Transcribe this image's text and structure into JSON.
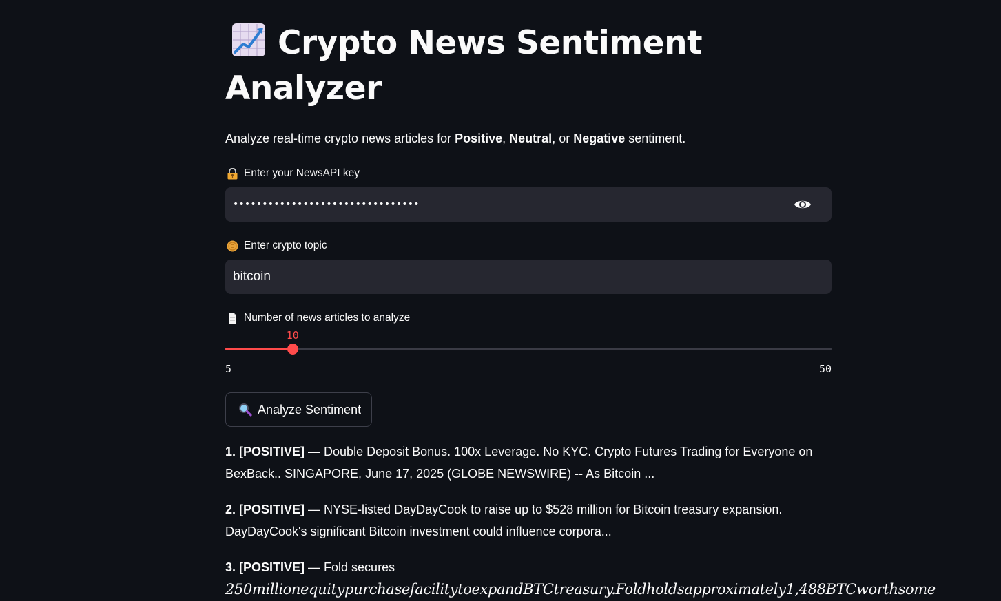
{
  "header": {
    "title": "Crypto News Sentiment Analyzer",
    "title_icon": "chart-increasing-icon"
  },
  "intro": {
    "prefix": "Analyze real-time crypto news articles for ",
    "positive": "Positive",
    "sep1": ", ",
    "neutral": "Neutral",
    "sep2": ", or ",
    "negative": "Negative",
    "suffix": " sentiment."
  },
  "api_key": {
    "label": "Enter your NewsAPI key",
    "icon": "locked-with-key-icon",
    "masked_value": "••••••••••••••••••••••••••••••••",
    "toggle_icon": "eye-icon"
  },
  "topic": {
    "label": "Enter crypto topic",
    "icon": "coin-icon",
    "value": "bitcoin"
  },
  "articles_slider": {
    "label": "Number of news articles to analyze",
    "icon": "page-icon",
    "value": 10,
    "value_text": "10",
    "min": 5,
    "min_text": "5",
    "max": 50,
    "max_text": "50",
    "accent_color": "#ff4b4b"
  },
  "analyze_button": {
    "label": "Analyze Sentiment",
    "icon": "magnifying-glass-icon"
  },
  "results": [
    {
      "tag": "1. [POSITIVE]",
      "text": " — Double Deposit Bonus. 100x Leverage. No KYC. Crypto Futures Trading for Everyone on BexBack.. SINGAPORE, June 17, 2025 (GLOBE NEWSWIRE) -- As Bitcoin ..."
    },
    {
      "tag": "2. [POSITIVE]",
      "text": " — NYSE-listed DayDayCook to raise up to $528 million for Bitcoin treasury expansion. DayDayCook's significant Bitcoin investment could influence corpora..."
    },
    {
      "tag": "3. [POSITIVE]",
      "text": " — Fold secures",
      "math_text": "250millionequitypurchasefacilitytoexpandBTCtreasury.Foldholdsapproximately1,488BTCworthsome"
    }
  ],
  "colors": {
    "background": "#0e1117",
    "input_background": "#262730",
    "accent": "#ff4b4b",
    "text": "#fafafa"
  }
}
